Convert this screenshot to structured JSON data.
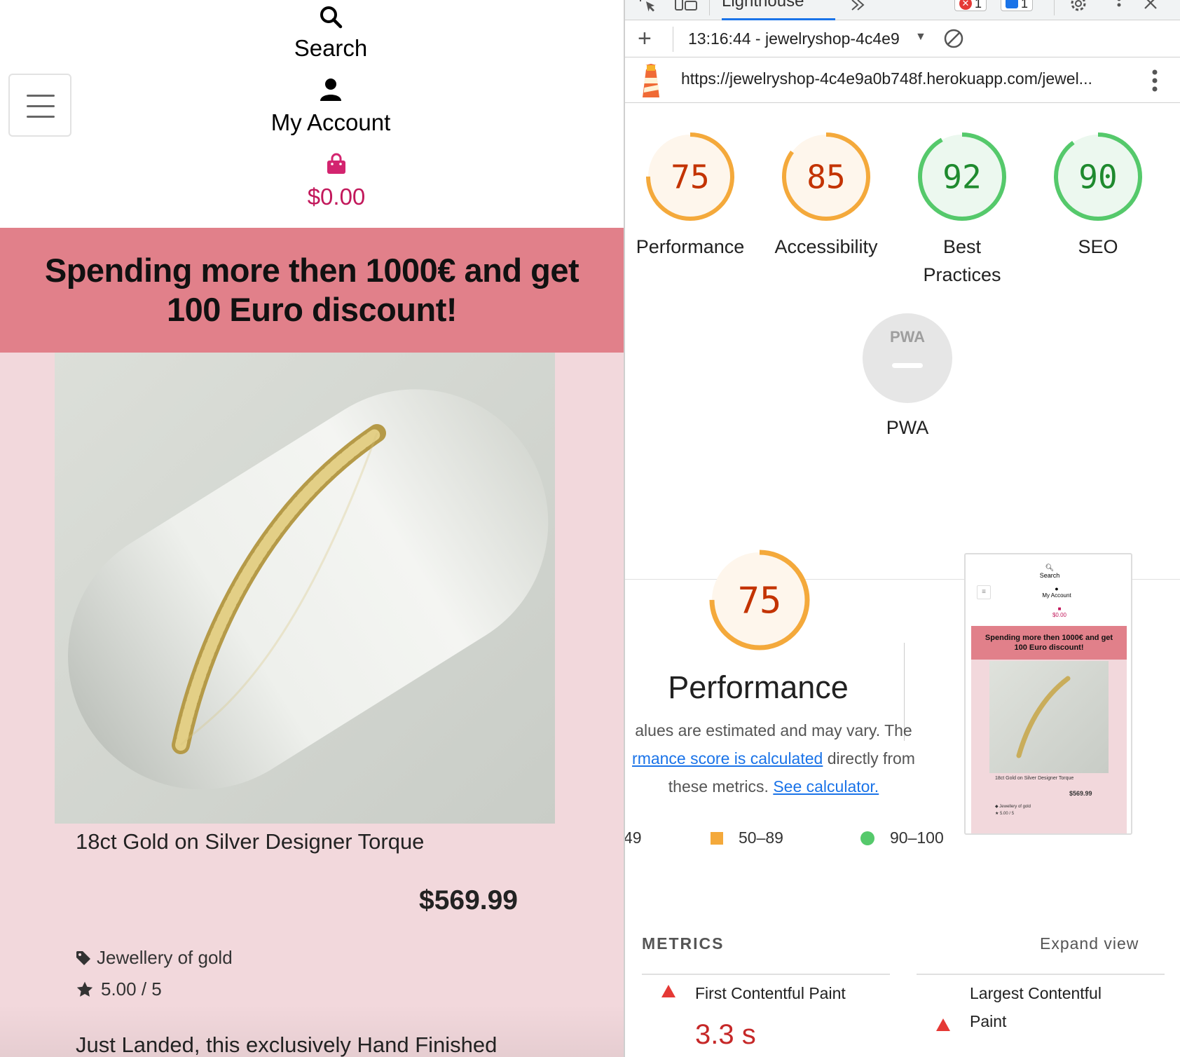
{
  "shop": {
    "search_label": "Search",
    "account_label": "My Account",
    "cart_total": "$0.00",
    "promo": "Spending more then 1000€ and get 100 Euro discount!",
    "product": {
      "name": "18ct Gold on Silver Designer Torque",
      "price": "$569.99",
      "category": "Jewellery of gold",
      "rating": "5.00 / 5",
      "description": "Just Landed, this exclusively Hand Finished"
    }
  },
  "devtools": {
    "active_tab": "Lighthouse",
    "error_count": "1",
    "message_count": "1",
    "report_selector": "13:16:44 - jewelryshop-4c4e9",
    "url": "https://jewelryshop-4c4e9a0b748f.herokuapp.com/jewel...",
    "scores": [
      {
        "label": "Performance",
        "value": 75,
        "status": "average"
      },
      {
        "label": "Accessibility",
        "value": 85,
        "status": "average"
      },
      {
        "label": "Best Practices",
        "value": 92,
        "status": "pass"
      },
      {
        "label": "SEO",
        "value": 90,
        "status": "pass"
      }
    ],
    "pwa_label": "PWA",
    "pwa_badge": "PWA",
    "performance": {
      "score": 75,
      "title": "Performance",
      "desc_line1": "alues are estimated and may vary. The",
      "desc_link1": "rmance score is calculated",
      "desc_line2_rest": " directly from",
      "desc_line3": "these metrics. ",
      "desc_link2": "See calculator.",
      "legend": [
        "49",
        "50–89",
        "90–100"
      ]
    },
    "thumbnail": {
      "search": "Search",
      "account": "My Account",
      "cart": "$0.00",
      "promo": "Spending more then 1000€ and get 100 Euro discount!",
      "name": "18ct Gold on Silver Designer Torque",
      "price": "$569.99",
      "category": "Jewellery of gold",
      "rating": "5.00 / 5"
    },
    "metrics_label": "METRICS",
    "expand_view": "Expand view",
    "metrics": [
      {
        "name": "First Contentful Paint",
        "value": "3.3 s"
      },
      {
        "name": "Largest Contentful Paint",
        "value": ""
      }
    ],
    "colors": {
      "average_fill": "#fef6ec",
      "average_stroke": "#f4a93b",
      "average_text": "#c33300",
      "pass_fill": "#ecf8ef",
      "pass_stroke": "#55c96b",
      "pass_text": "#1e8a2e",
      "fail": "#e53935"
    }
  }
}
